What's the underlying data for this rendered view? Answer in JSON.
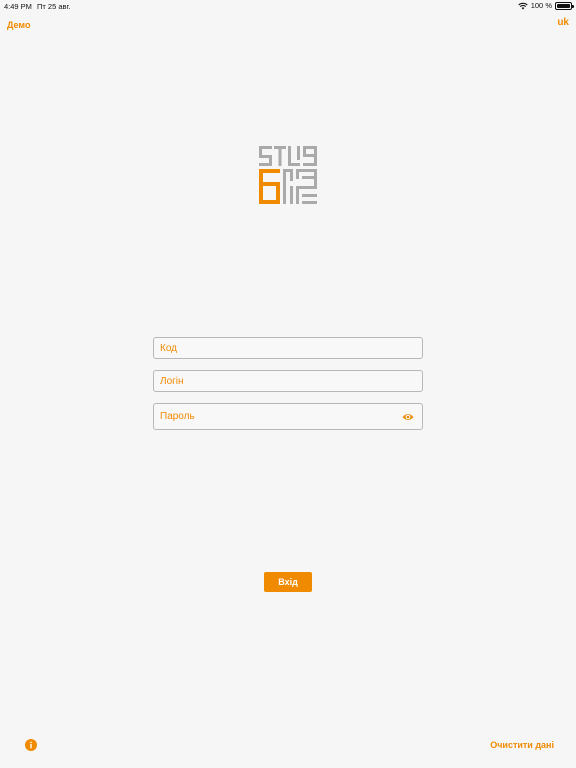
{
  "status_bar": {
    "time": "4:49 PM",
    "date": "Пт 25 авг.",
    "battery_text": "100 %",
    "icons": [
      "wifi-icon",
      "battery-icon"
    ]
  },
  "header": {
    "demo_label": "Демо",
    "language_label": "uk"
  },
  "logo": {
    "icon": "app-logo"
  },
  "form": {
    "code_placeholder": "Код",
    "login_placeholder": "Логін",
    "password_placeholder": "Пароль",
    "password_toggle_icon": "eye-icon",
    "submit_label": "Вхід"
  },
  "footer": {
    "info_icon": "info-icon",
    "clear_label": "Очистити дані"
  },
  "colors": {
    "accent": "#f08a00",
    "background": "#f6f6f6",
    "logo_gray": "#aaaaaa"
  }
}
